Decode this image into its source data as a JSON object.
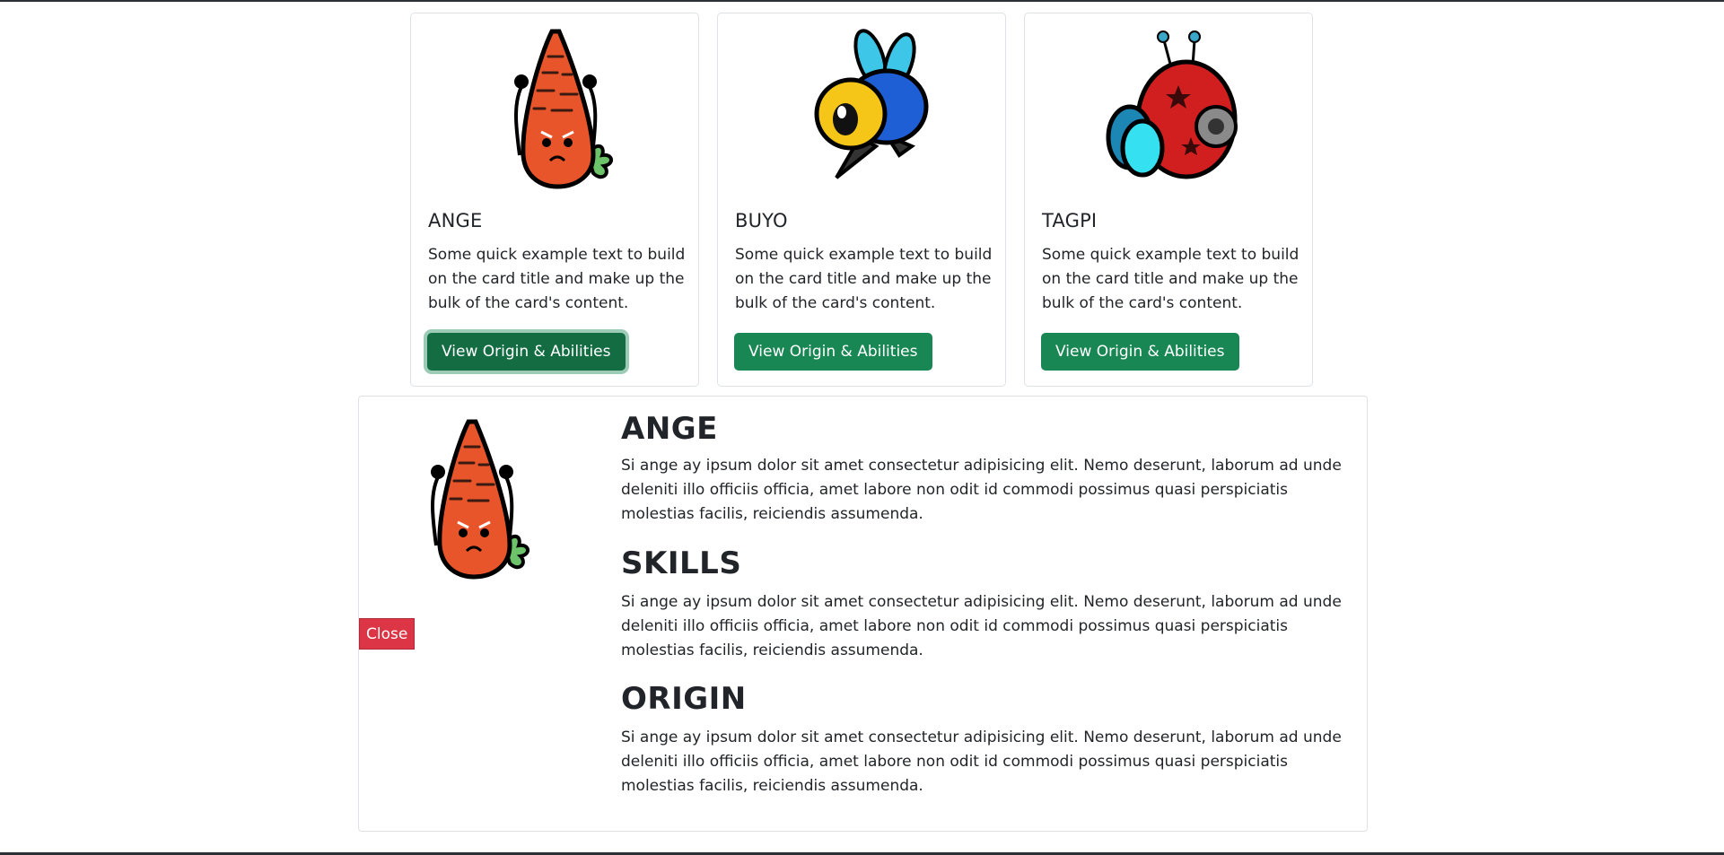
{
  "cards": [
    {
      "title": "ANGE",
      "text": "Some quick example text to build on the card title and make up the bulk of the card's content.",
      "button": "View Origin & Abilities",
      "icon": "carrot-icon"
    },
    {
      "title": "BUYO",
      "text": "Some quick example text to build on the card title and make up the bulk of the card's content.",
      "button": "View Origin & Abilities",
      "icon": "bee-icon"
    },
    {
      "title": "TAGPI",
      "text": "Some quick example text to build on the card title and make up the bulk of the card's content.",
      "button": "View Origin & Abilities",
      "icon": "ladybug-icon"
    }
  ],
  "detail": {
    "close_label": "Close",
    "name": "ANGE",
    "name_text": "Si ange ay ipsum dolor sit amet consectetur adipisicing elit. Nemo deserunt, laborum ad unde deleniti illo officiis officia, amet labore non odit id commodi possimus quasi perspiciatis molestias facilis, reiciendis assumenda.",
    "skills_heading": "SKILLS",
    "skills_text": "Si ange ay ipsum dolor sit amet consectetur adipisicing elit. Nemo deserunt, laborum ad unde deleniti illo officiis officia, amet labore non odit id commodi possimus quasi perspiciatis molestias facilis, reiciendis assumenda.",
    "origin_heading": "ORIGIN",
    "origin_text": "Si ange ay ipsum dolor sit amet consectetur adipisicing elit. Nemo deserunt, laborum ad unde deleniti illo officiis officia, amet labore non odit id commodi possimus quasi perspiciatis molestias facilis, reiciendis assumenda."
  },
  "colors": {
    "button_green": "#198754",
    "button_red": "#dc3545",
    "carrot": "#e8552b"
  }
}
